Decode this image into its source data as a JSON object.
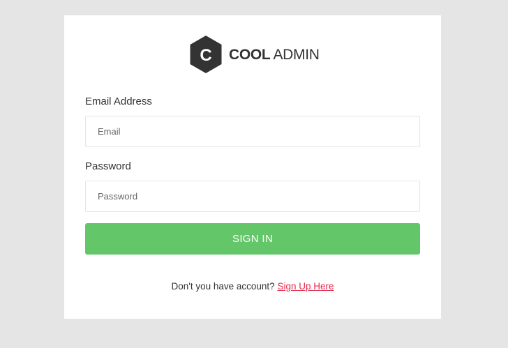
{
  "logo": {
    "icon_letter": "C",
    "name_bold": "COOL",
    "name_light": "ADMIN"
  },
  "form": {
    "email_label": "Email Address",
    "email_placeholder": "Email",
    "email_value": "",
    "password_label": "Password",
    "password_placeholder": "Password",
    "password_value": "",
    "submit_label": "SIGN IN"
  },
  "footer": {
    "prompt": "Don't you have account?",
    "signup_link": "Sign Up Here"
  },
  "colors": {
    "background": "#e5e5e5",
    "button": "#63c76a",
    "link": "#e5294b",
    "logo_hex": "#333333"
  }
}
